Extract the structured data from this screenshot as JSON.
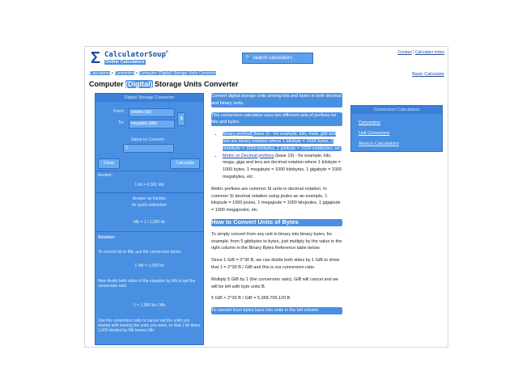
{
  "header": {
    "logo_name": "CalculatorSoup",
    "logo_reg": "®",
    "logo_tagline": "Online Calculators",
    "search_placeholder": "search calculators",
    "top_links": [
      "Contact",
      "Calculator Index"
    ]
  },
  "breadcrumb": [
    "Calculators",
    "Converters",
    "Computer (Digital) Storage Units Converter"
  ],
  "basic_calculator": "Basic Calculator",
  "page_title_a": "Computer ",
  "page_title_b": "(Digital)",
  "page_title_c": " Storage Units Converter",
  "calculator": {
    "title": "Digital Storage Converter",
    "from_label": "From:",
    "to_label": "To:",
    "from_value": "kilobits (kb)",
    "to_value": "megabits (Mb)",
    "swap": "⇅",
    "value_label": "Value to Convert",
    "value": "1",
    "clear": "Clear",
    "calculate": "Calculate",
    "answer_label": "Answer:",
    "answer_value": "1 kb = 0.001 Mb",
    "fraction_line1": "Answer as fraction",
    "fraction_line2": "for quick estimation",
    "fraction_value": "Mb = 1 / 1,000 kb",
    "solution_label": "Solution:",
    "solution_text": "To convert kb to Mb, use the conversion factor",
    "factor_line": "1 Mb = 1,000 kb",
    "divide_text": "Now divide both sides of the equation by Mb to get the conversion ratio",
    "ratio_line": "1 = 1,000 kb / Mb",
    "multiply_text": "Use the conversion ratio to cancel out the units you started with leaving the units you want, so that 1 kb times 1,000 divided by Mb leaves Mb."
  },
  "content": {
    "p1": "Convert digital storage units among bits and bytes in both decimal and binary units.",
    "p2": "This conversion calculator uses two different sets of prefixes for bits and bytes.",
    "li1_title": "Binary prefixes",
    "li1_text": " (base 2) - for example, kibi, mebi, gibi and tebi are binary notation where 1 kibibyte = 1024 bytes, 1 mebibyte = 1024 kibibytes, 1 gibibyte = 1024 mebibytes, etc.",
    "li2_title": "Metric or Decimal prefixes",
    "li2_text": " (base 10) - for example, kilo, mega, giga and tera are decimal notation where 1 kilobyte = 1000 bytes, 1 megabyte = 1000 kilobytes, 1 gigabyte = 1000 megabytes, etc.",
    "p3": "Metric prefixes are common SI units in decimal notation. In common SI decimal notation using joules as an example, 1 kilojoule = 1000 joules, 1 megajoule = 1000 kilojoules, 1 gigajoule = 1000 megajoules, etc.",
    "h2": "How to Convert Units of Bytes",
    "p4": "To simply convert from any unit in binary into binary bytes, for example, from 5 gibibytes to bytes, just multiply by the value in the right column in the Binary Bytes Reference table below.",
    "p5": "Since 1 GiB = 2^30 B, we can divide both sides by 1 GiB to show that 1 = 2^30 B / GiB and this is our conversion ratio.",
    "p6": "Multiply 5 GiB by 1 (the conversion ratio), GiB will cancel and we will be left with byte units B.",
    "p7": "5 GiB × 2^30 B / GiB = 5,368,709,120 B",
    "p8": "To convert from bytes back into units in the left column"
  },
  "sidebar": {
    "title": "Conversion Calculators",
    "links": [
      "Converters",
      "Unit Converters",
      "Abacus Calculations"
    ]
  },
  "colors": {
    "highlight": "#4a90e2",
    "brand": "#1e4b9e"
  }
}
